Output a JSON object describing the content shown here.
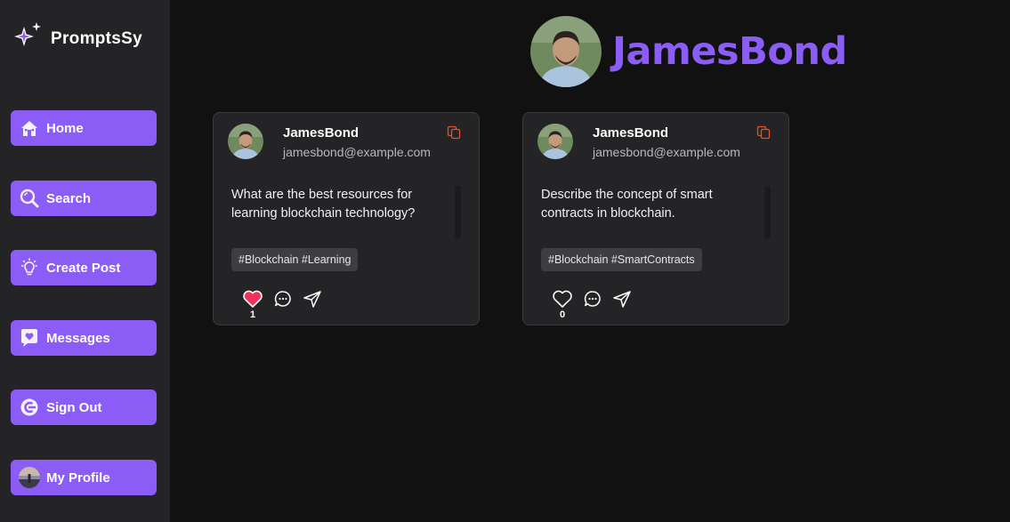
{
  "brand": {
    "name": "PromptsSy",
    "icon": "sparkle-icon"
  },
  "nav": {
    "items": [
      {
        "label": "Home",
        "icon": "home-icon"
      },
      {
        "label": "Search",
        "icon": "search-icon"
      },
      {
        "label": "Create Post",
        "icon": "lightbulb-icon"
      },
      {
        "label": "Messages",
        "icon": "message-heart-icon"
      },
      {
        "label": "Sign Out",
        "icon": "sign-out-icon"
      },
      {
        "label": "My Profile",
        "icon": "avatar"
      }
    ]
  },
  "profile": {
    "name": "JamesBond"
  },
  "posts": [
    {
      "user": "JamesBond",
      "email": "jamesbond@example.com",
      "text": "What are the best resources for learning blockchain technology?",
      "tags": "#Blockchain #Learning",
      "likes": "1",
      "liked": true
    },
    {
      "user": "JamesBond",
      "email": "jamesbond@example.com",
      "text": "Describe the concept of smart contracts in blockchain.",
      "tags": "#Blockchain #SmartContracts",
      "likes": "0",
      "liked": false
    }
  ],
  "colors": {
    "accent": "#8c5cf6",
    "like": "#f0315a",
    "copy": "#e0542a",
    "sidebar": "#242325",
    "background": "#121112"
  }
}
